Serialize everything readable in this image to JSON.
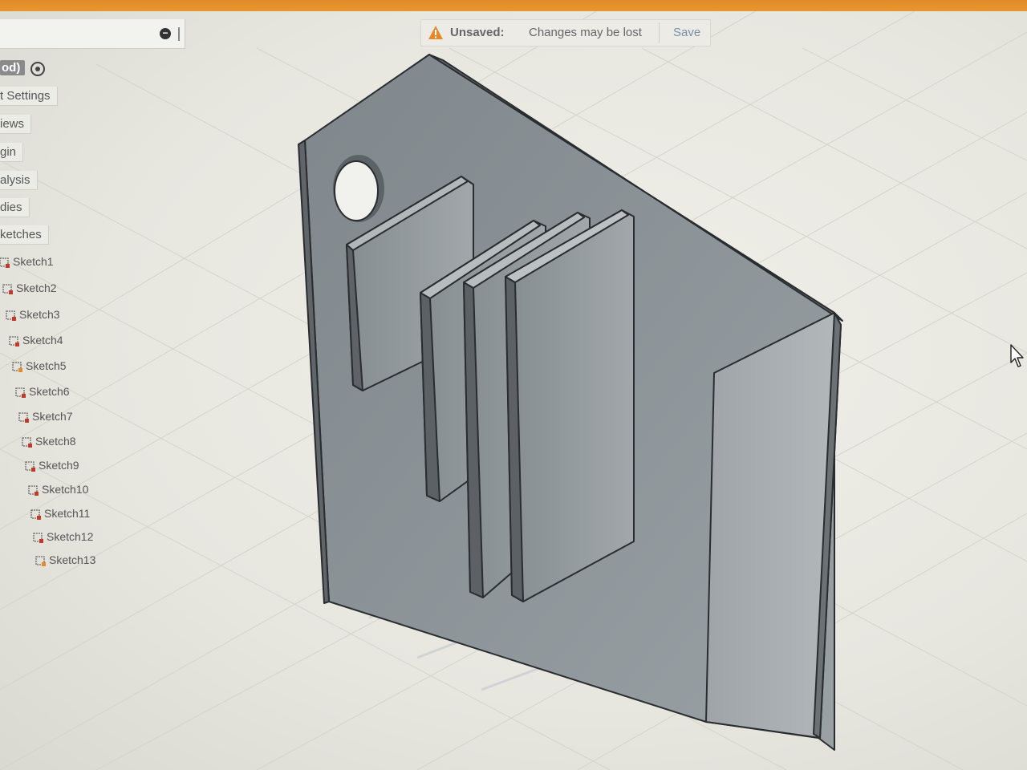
{
  "banner": {
    "status_label": "Unsaved:",
    "message": "Changes may be lost",
    "save_label": "Save"
  },
  "browser": {
    "nodes": [
      {
        "label": "od)"
      },
      {
        "label": "t Settings"
      },
      {
        "label": "iews"
      },
      {
        "label": "gin"
      },
      {
        "label": "alysis"
      },
      {
        "label": "dies"
      },
      {
        "label": "ketches"
      }
    ],
    "sketches": [
      {
        "label": "Sketch1"
      },
      {
        "label": "Sketch2"
      },
      {
        "label": "Sketch3"
      },
      {
        "label": "Sketch4"
      },
      {
        "label": "Sketch5"
      },
      {
        "label": "Sketch6"
      },
      {
        "label": "Sketch7"
      },
      {
        "label": "Sketch8"
      },
      {
        "label": "Sketch9"
      },
      {
        "label": "Sketch10"
      },
      {
        "label": "Sketch11"
      },
      {
        "label": "Sketch12"
      },
      {
        "label": "Sketch13"
      }
    ]
  },
  "colors": {
    "titlebar": "#e9962f",
    "warning": "#e58a2b",
    "model_face": "#8c9397",
    "model_edge": "#2a2d2f",
    "sketch_icon_accent": "#c0392b"
  },
  "icons": {
    "warning": "warning-triangle-icon",
    "clear": "clear-circle-icon",
    "visibility": "radio-visibility-icon",
    "sketch": "sketch-profile-icon",
    "cursor": "mouse-pointer-icon"
  }
}
